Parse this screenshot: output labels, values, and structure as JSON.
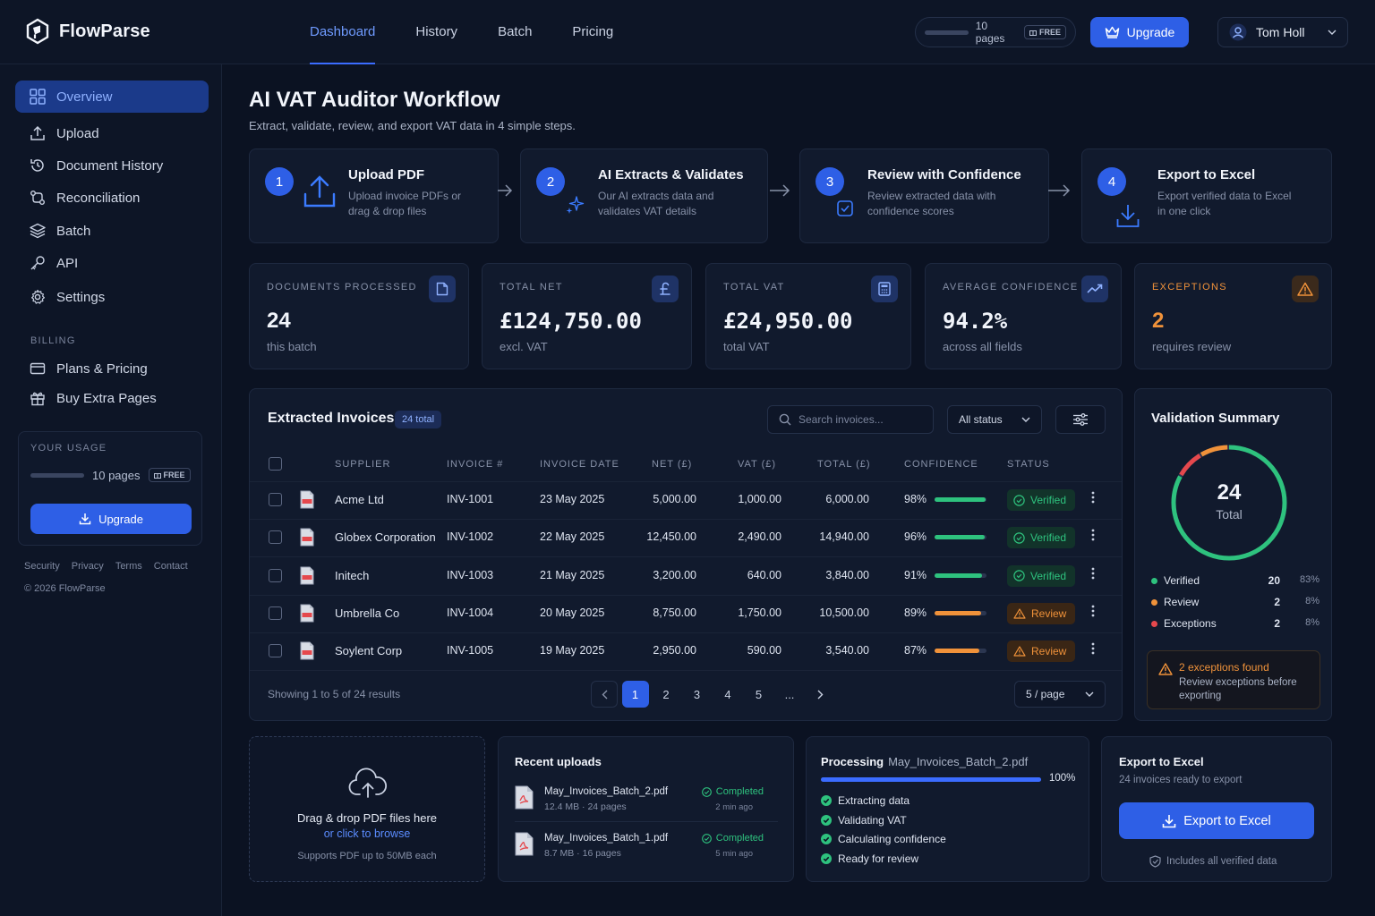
{
  "brand": {
    "name": "FlowParse"
  },
  "nav": {
    "items": [
      "Dashboard",
      "History",
      "Batch",
      "Pricing"
    ],
    "active": "Dashboard"
  },
  "top_usage": {
    "pages": "10 pages",
    "plan": "FREE"
  },
  "top_upgrade_label": "Upgrade",
  "user": {
    "name": "Tom Holl"
  },
  "sidebar": {
    "items": [
      {
        "label": "Overview",
        "icon": "grid-icon"
      },
      {
        "label": "Upload",
        "icon": "upload-icon"
      },
      {
        "label": "Document History",
        "icon": "history-icon"
      },
      {
        "label": "Reconciliation",
        "icon": "reconcile-icon"
      },
      {
        "label": "Batch",
        "icon": "layers-icon"
      },
      {
        "label": "API",
        "icon": "key-icon"
      },
      {
        "label": "Settings",
        "icon": "gear-icon"
      }
    ],
    "billing_heading": "BILLING",
    "billing_items": [
      {
        "label": "Plans & Pricing",
        "icon": "card-icon"
      },
      {
        "label": "Buy Extra Pages",
        "icon": "gift-icon"
      }
    ],
    "usage": {
      "title": "YOUR USAGE",
      "pages": "10 pages",
      "plan": "FREE",
      "button": "Upgrade"
    },
    "footer_links": [
      "Security",
      "Privacy",
      "Terms",
      "Contact"
    ],
    "copyright": "© 2026 FlowParse"
  },
  "page": {
    "title": "AI VAT Auditor Workflow",
    "subtitle": "Extract, validate, review, and export VAT data in 4 simple steps."
  },
  "steps": [
    {
      "num": "1",
      "title": "Upload PDF",
      "desc": "Upload invoice PDFs or drag & drop files",
      "icon": "upload-icon"
    },
    {
      "num": "2",
      "title": "AI Extracts & Validates",
      "desc": "Our AI extracts data and validates VAT details",
      "icon": "sparkle-icon"
    },
    {
      "num": "3",
      "title": "Review with Confidence",
      "desc": "Review extracted data with confidence scores",
      "icon": "check-square-icon"
    },
    {
      "num": "4",
      "title": "Export to Excel",
      "desc": "Export verified data to Excel in one click",
      "icon": "download-icon"
    }
  ],
  "stats": [
    {
      "label": "DOCUMENTS PROCESSED",
      "value": "24",
      "sub": "this batch",
      "icon": "document-icon"
    },
    {
      "label": "TOTAL NET",
      "value": "£124,750.00",
      "sub": "excl. VAT",
      "icon": "pound-icon"
    },
    {
      "label": "TOTAL VAT",
      "value": "£24,950.00",
      "sub": "total VAT",
      "icon": "calculator-icon"
    },
    {
      "label": "AVERAGE CONFIDENCE",
      "value": "94.2%",
      "sub": "across all fields",
      "icon": "trend-icon"
    },
    {
      "label": "EXCEPTIONS",
      "value": "2",
      "sub": "requires review",
      "icon": "warning-icon"
    }
  ],
  "invoices": {
    "title": "Extracted Invoices",
    "count_badge": "24 total",
    "search_placeholder": "Search invoices...",
    "status_filter": "All status",
    "columns": [
      "SUPPLIER",
      "INVOICE #",
      "INVOICE DATE",
      "NET (£)",
      "VAT (£)",
      "TOTAL (£)",
      "CONFIDENCE",
      "STATUS"
    ],
    "rows": [
      {
        "supplier": "Acme Ltd",
        "invoice": "INV-1001",
        "date": "23 May 2025",
        "net": "5,000.00",
        "vat": "1,000.00",
        "total": "6,000.00",
        "confidence": "98%",
        "confidence_value": 98,
        "status": "Verified"
      },
      {
        "supplier": "Globex Corporation",
        "invoice": "INV-1002",
        "date": "22 May 2025",
        "net": "12,450.00",
        "vat": "2,490.00",
        "total": "14,940.00",
        "confidence": "96%",
        "confidence_value": 96,
        "status": "Verified"
      },
      {
        "supplier": "Initech",
        "invoice": "INV-1003",
        "date": "21 May 2025",
        "net": "3,200.00",
        "vat": "640.00",
        "total": "3,840.00",
        "confidence": "91%",
        "confidence_value": 91,
        "status": "Verified"
      },
      {
        "supplier": "Umbrella Co",
        "invoice": "INV-1004",
        "date": "20 May 2025",
        "net": "8,750.00",
        "vat": "1,750.00",
        "total": "10,500.00",
        "confidence": "89%",
        "confidence_value": 89,
        "status": "Review"
      },
      {
        "supplier": "Soylent Corp",
        "invoice": "INV-1005",
        "date": "19 May 2025",
        "net": "2,950.00",
        "vat": "590.00",
        "total": "3,540.00",
        "confidence": "87%",
        "confidence_value": 87,
        "status": "Review"
      }
    ],
    "showing": "Showing 1 to 5 of 24 results",
    "pages": [
      "1",
      "2",
      "3",
      "4",
      "5",
      "..."
    ],
    "current_page": "1",
    "page_size": "5 / page"
  },
  "validation": {
    "title": "Validation Summary",
    "total": "24",
    "total_label": "Total",
    "items": [
      {
        "name": "Verified",
        "count": "20",
        "pct": "83%",
        "value": 20,
        "color": "#2ec27e"
      },
      {
        "name": "Review",
        "count": "2",
        "pct": "8%",
        "value": 2,
        "color": "#f0923a"
      },
      {
        "name": "Exceptions",
        "count": "2",
        "pct": "8%",
        "value": 2,
        "color": "#e5484d"
      }
    ],
    "exception_title": "2 exceptions found",
    "exception_desc": "Review exceptions before exporting"
  },
  "dropzone": {
    "title": "Drag & drop PDF files here",
    "link": "or click to browse",
    "note": "Supports PDF up to 50MB each"
  },
  "recent_uploads": {
    "title": "Recent uploads",
    "items": [
      {
        "name": "May_Invoices_Batch_2.pdf",
        "size": "12.4 MB",
        "pages": "24 pages",
        "status": "Completed",
        "ago": "2 min ago"
      },
      {
        "name": "May_Invoices_Batch_1.pdf",
        "size": "8.7 MB",
        "pages": "16 pages",
        "status": "Completed",
        "ago": "5 min ago"
      }
    ]
  },
  "processing": {
    "title": "Processing",
    "file": "May_Invoices_Batch_2.pdf",
    "percent": "100%",
    "progress": 1.0,
    "steps": [
      "Extracting data",
      "Validating VAT",
      "Calculating confidence",
      "Ready for review"
    ]
  },
  "export": {
    "title": "Export to Excel",
    "sub": "24 invoices ready to export",
    "button": "Export to Excel",
    "note": "Includes all verified data"
  },
  "colors": {
    "accent": "#2e5fe6",
    "verified": "#2ec27e",
    "review": "#f0923a",
    "exception": "#e5484d"
  }
}
